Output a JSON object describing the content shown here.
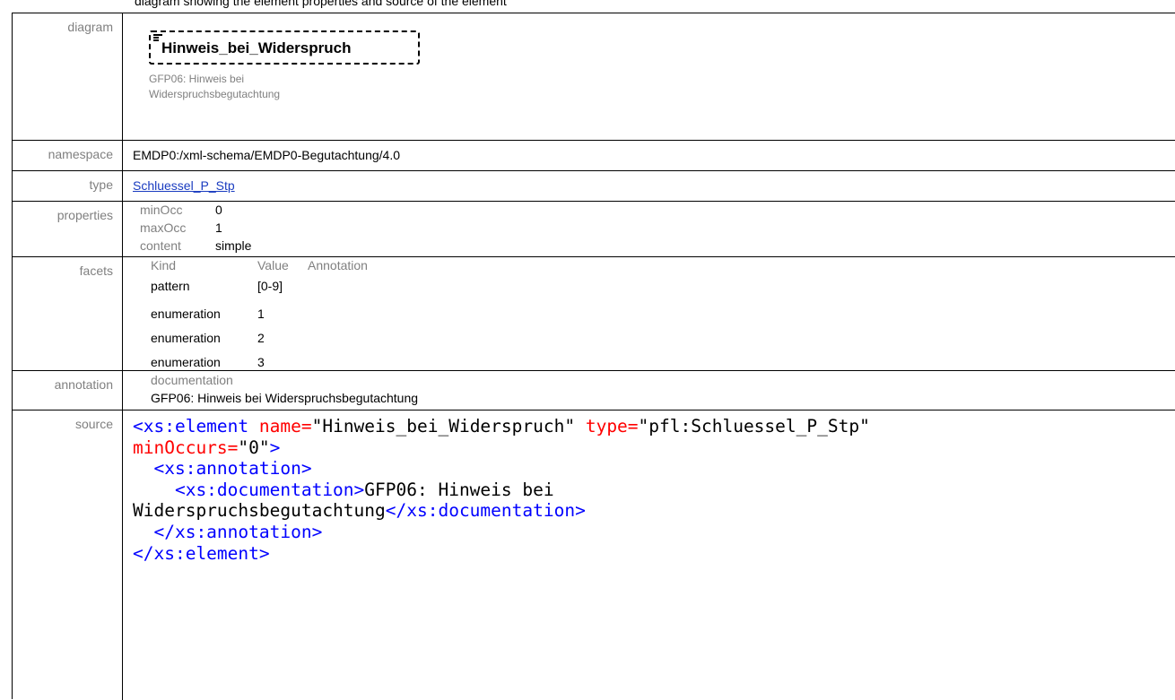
{
  "caption": "diagram showing the element properties and source of the element",
  "rows": {
    "diagram": {
      "label": "diagram",
      "element_name": "Hinweis_bei_Widerspruch",
      "doc_line1": "GFP06: Hinweis bei",
      "doc_line2": "Widerspruchsbegutachtung"
    },
    "namespace": {
      "label": "namespace",
      "value": "EMDP0:/xml-schema/EMDP0-Begutachtung/4.0"
    },
    "type": {
      "label": "type",
      "value": "Schluessel_P_Stp"
    },
    "properties": {
      "label": "properties",
      "items": [
        {
          "key": "minOcc",
          "value": "0"
        },
        {
          "key": "maxOcc",
          "value": "1"
        },
        {
          "key": "content",
          "value": "simple"
        }
      ]
    },
    "facets": {
      "label": "facets",
      "headers": [
        "Kind",
        "Value",
        "Annotation"
      ],
      "items": [
        {
          "kind": "pattern",
          "value": "[0-9]"
        },
        {
          "kind": "enumeration",
          "value": "1"
        },
        {
          "kind": "enumeration",
          "value": "2"
        },
        {
          "kind": "enumeration",
          "value": "3"
        }
      ]
    },
    "annotation": {
      "label": "annotation",
      "key": "documentation",
      "value": "GFP06: Hinweis bei Widerspruchsbegutachtung"
    },
    "source": {
      "label": "source",
      "lines": [
        [
          "<xs:element",
          " name=",
          "\"Hinweis_bei_Widerspruch\"",
          " type=",
          "\"pfl:Schluessel_P_Stp\""
        ],
        [
          "minOccurs=",
          "\"0\"",
          ">"
        ],
        [
          "  <xs:annotation>"
        ],
        [
          "    <xs:documentation>",
          "GFP06: Hinweis bei"
        ],
        [
          "Widerspruchsbegutachtung",
          "</xs:documentation>"
        ],
        [
          "  </xs:annotation>"
        ],
        [
          "</xs:element>"
        ]
      ]
    }
  }
}
